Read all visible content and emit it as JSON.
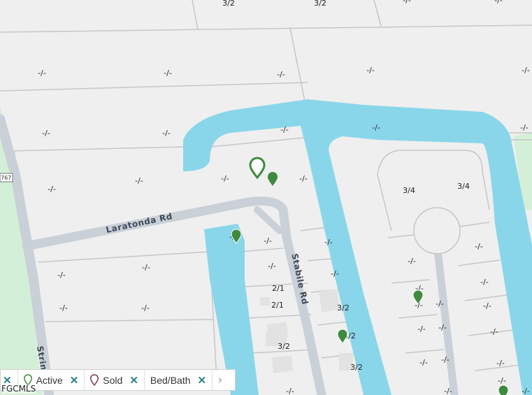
{
  "map": {
    "roads": {
      "laratonda": "Laratonda Rd",
      "stabile": "Stabile Rd",
      "stringer": "Stringer",
      "shield": "767"
    },
    "lots": [
      {
        "id": "lot-1",
        "text": "3/2"
      },
      {
        "id": "lot-2",
        "text": "3/2"
      },
      {
        "id": "lot-3",
        "text": "-/-"
      },
      {
        "id": "lot-4",
        "text": "-/-"
      },
      {
        "id": "lot-5",
        "text": "-/-"
      },
      {
        "id": "lot-6",
        "text": "-/-"
      },
      {
        "id": "lot-7",
        "text": "-/-"
      },
      {
        "id": "lot-8",
        "text": "-/-"
      },
      {
        "id": "lot-9",
        "text": "-/-"
      },
      {
        "id": "lot-10",
        "text": "-/-"
      },
      {
        "id": "lot-11",
        "text": "-/-"
      },
      {
        "id": "lot-12",
        "text": "-/-"
      },
      {
        "id": "lot-13",
        "text": "-/-"
      },
      {
        "id": "lot-14",
        "text": "-/-"
      },
      {
        "id": "lot-15",
        "text": "-/-"
      },
      {
        "id": "lot-16",
        "text": "-/-"
      },
      {
        "id": "lot-17",
        "text": "-/-"
      },
      {
        "id": "lot-18",
        "text": "-/-"
      },
      {
        "id": "lot-19",
        "text": "3/4"
      },
      {
        "id": "lot-20",
        "text": "3/4"
      },
      {
        "id": "lot-21",
        "text": "-/-"
      },
      {
        "id": "lot-22",
        "text": "-/-"
      },
      {
        "id": "lot-23",
        "text": "-/-"
      },
      {
        "id": "lot-24",
        "text": "-/-"
      },
      {
        "id": "lot-25",
        "text": "-/-"
      },
      {
        "id": "lot-26",
        "text": "-/-"
      },
      {
        "id": "lot-27",
        "text": "-/-"
      },
      {
        "id": "lot-28",
        "text": "-/-"
      },
      {
        "id": "lot-29",
        "text": "2/1"
      },
      {
        "id": "lot-30",
        "text": "-/-"
      },
      {
        "id": "lot-31",
        "text": "-/-"
      },
      {
        "id": "lot-32",
        "text": "-/-"
      },
      {
        "id": "lot-33",
        "text": "-/-"
      },
      {
        "id": "lot-34",
        "text": "2/1"
      },
      {
        "id": "lot-35",
        "text": "3/2"
      },
      {
        "id": "lot-36",
        "text": "-/-"
      },
      {
        "id": "lot-37",
        "text": "-/-"
      },
      {
        "id": "lot-38",
        "text": "-/-"
      },
      {
        "id": "lot-39",
        "text": "-/-"
      },
      {
        "id": "lot-40",
        "text": "-/-"
      },
      {
        "id": "lot-41",
        "text": "3/2"
      },
      {
        "id": "lot-42",
        "text": "3/2"
      },
      {
        "id": "lot-43",
        "text": "-/-"
      },
      {
        "id": "lot-44",
        "text": "3/2"
      },
      {
        "id": "lot-45",
        "text": "-/-"
      },
      {
        "id": "lot-46",
        "text": "-/-"
      },
      {
        "id": "lot-47",
        "text": "-/-"
      },
      {
        "id": "lot-48",
        "text": "-/-"
      },
      {
        "id": "lot-49",
        "text": "-/-"
      },
      {
        "id": "lot-50",
        "text": "-/-"
      },
      {
        "id": "lot-51",
        "text": "-/-"
      },
      {
        "id": "lot-52",
        "text": "-/-"
      }
    ],
    "colors": {
      "water": "#89d6ea",
      "road": "#c9d0d8",
      "parcel_bg": "#efefef",
      "parcel_line": "#c8c8c8",
      "park": "#d3efd7",
      "active_pin": "#3e8a3e",
      "sold_pin": "#7a3b4c"
    }
  },
  "legend": {
    "items": [
      {
        "label": "Active",
        "pin_color": "#3e8a3e",
        "icon": "map-pin-icon"
      },
      {
        "label": "Sold",
        "pin_color": "#7a3b4c",
        "icon": "map-pin-icon"
      },
      {
        "label": "Bed/Bath"
      }
    ],
    "remove_symbol": "✕",
    "next_symbol": "›"
  },
  "attribution": "FGCMLS"
}
